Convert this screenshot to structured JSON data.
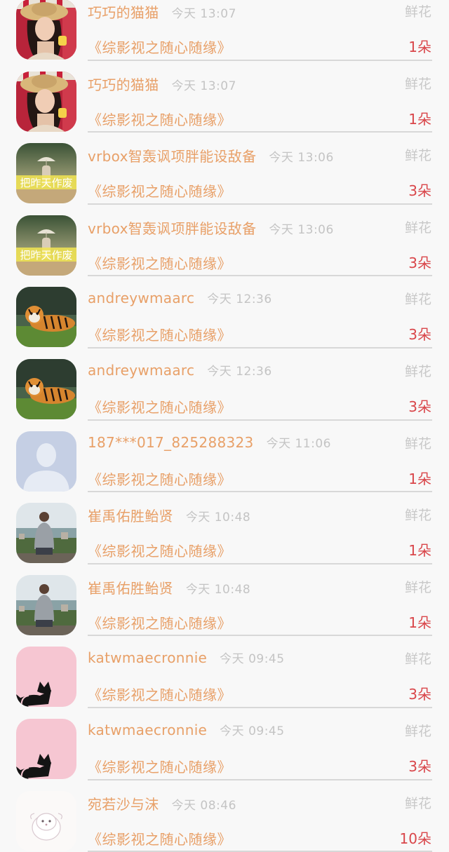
{
  "records": [
    {
      "username": "巧巧的猫猫",
      "time": "今天 13:07",
      "gift_type": "鲜花",
      "work_title": "《综影视之随心随缘》",
      "count": "1朵",
      "avatar": "woman-hat"
    },
    {
      "username": "巧巧的猫猫",
      "time": "今天 13:07",
      "gift_type": "鲜花",
      "work_title": "《综影视之随心随缘》",
      "count": "1朵",
      "avatar": "woman-hat"
    },
    {
      "username": "vrbox智轰讽项胖能设敌备",
      "time": "今天 13:06",
      "gift_type": "鲜花",
      "work_title": "《综影视之随心随缘》",
      "count": "3朵",
      "avatar": "umbrella-girl"
    },
    {
      "username": "vrbox智轰讽项胖能设敌备",
      "time": "今天 13:06",
      "gift_type": "鲜花",
      "work_title": "《综影视之随心随缘》",
      "count": "3朵",
      "avatar": "umbrella-girl"
    },
    {
      "username": "andreywmaarc",
      "time": "今天 12:36",
      "gift_type": "鲜花",
      "work_title": "《综影视之随心随缘》",
      "count": "3朵",
      "avatar": "tiger"
    },
    {
      "username": "andreywmaarc",
      "time": "今天 12:36",
      "gift_type": "鲜花",
      "work_title": "《综影视之随心随缘》",
      "count": "3朵",
      "avatar": "tiger"
    },
    {
      "username": "187***017_825288323",
      "time": "今天 11:06",
      "gift_type": "鲜花",
      "work_title": "《综影视之随心随缘》",
      "count": "1朵",
      "avatar": "default-person"
    },
    {
      "username": "崔禹佑胜鲐贤",
      "time": "今天 10:48",
      "gift_type": "鲜花",
      "work_title": "《综影视之随心随缘》",
      "count": "1朵",
      "avatar": "man-city"
    },
    {
      "username": "崔禹佑胜鲐贤",
      "time": "今天 10:48",
      "gift_type": "鲜花",
      "work_title": "《综影视之随心随缘》",
      "count": "1朵",
      "avatar": "man-city"
    },
    {
      "username": "katwmaecronnie",
      "time": "今天 09:45",
      "gift_type": "鲜花",
      "work_title": "《综影视之随心随缘》",
      "count": "3朵",
      "avatar": "black-cat"
    },
    {
      "username": "katwmaecronnie",
      "time": "今天 09:45",
      "gift_type": "鲜花",
      "work_title": "《综影视之随心随缘》",
      "count": "3朵",
      "avatar": "black-cat"
    },
    {
      "username": "宛若沙与沫",
      "time": "今天 08:46",
      "gift_type": "鲜花",
      "work_title": "《综影视之随心随缘》",
      "count": "10朵",
      "avatar": "white-dog"
    }
  ],
  "avatar_text": {
    "umbrella-girl": "把昨天作废"
  }
}
